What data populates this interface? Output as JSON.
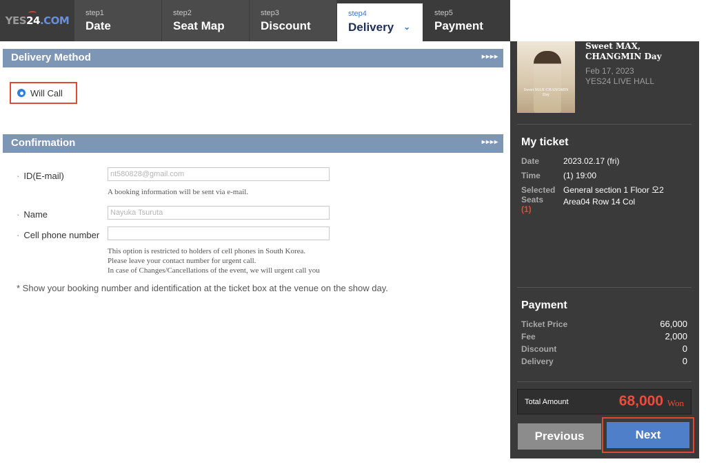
{
  "logo": {
    "prefix": "YES",
    "num": "24",
    "suffix": ".COM"
  },
  "steps": [
    {
      "num": "step1",
      "label": "Date"
    },
    {
      "num": "step2",
      "label": "Seat Map"
    },
    {
      "num": "step3",
      "label": "Discount"
    },
    {
      "num": "step4",
      "label": "Delivery"
    },
    {
      "num": "step5",
      "label": "Payment"
    }
  ],
  "active_step": "step4",
  "delivery": {
    "header": "Delivery Method",
    "arrows": "▸▸▸▸",
    "option": "Will Call"
  },
  "confirmation": {
    "header": "Confirmation",
    "arrows": "▸▸▸▸",
    "id_label": "ID(E-mail)",
    "id_value": "nt580828@gmail.com",
    "id_note": "A booking information will be sent via e-mail.",
    "name_label": "Name",
    "name_value": "Nayuka Tsuruta",
    "phone_label": "Cell phone number",
    "phone_value": "",
    "phone_note_1": "This option is restricted to holders of cell phones in South Korea.",
    "phone_note_2": "Please leave your contact number for urgent call.",
    "phone_note_3": "In case of Changes/Cancellations of the event, we will urgent call you",
    "bottom_note": "* Show your booking number and identification at the ticket box at the venue on the show day."
  },
  "show": {
    "title": "Sweet MAX, CHANGMIN Day",
    "date": "Feb 17, 2023",
    "venue": "YES24 LIVE HALL",
    "poster_text": "Sweet MAX CHANGMIN Day"
  },
  "ticket": {
    "heading": "My ticket",
    "date_label": "Date",
    "date_value": "2023.02.17 (fri)",
    "time_label": "Time",
    "time_value": "(1) 19:00",
    "seats_label_1": "Selected",
    "seats_label_2": "Seats",
    "seats_count": "(1)",
    "seats_value_1": "General section 1 Floor 오2",
    "seats_value_2": "Area04 Row 14 Col"
  },
  "payment": {
    "heading": "Payment",
    "price_label": "Ticket Price",
    "price_value": "66,000",
    "fee_label": "Fee",
    "fee_value": "2,000",
    "discount_label": "Discount",
    "discount_value": "0",
    "delivery_label": "Delivery",
    "delivery_value": "0",
    "total_label": "Total Amount",
    "total_value": "68,000",
    "total_unit": "Won"
  },
  "buttons": {
    "previous": "Previous",
    "next": "Next"
  },
  "colors": {
    "accent_red": "#ef4a3d",
    "accent_blue": "#4f7fc8",
    "section_head": "#7e96b6",
    "sidebar": "#3a3a3a"
  }
}
